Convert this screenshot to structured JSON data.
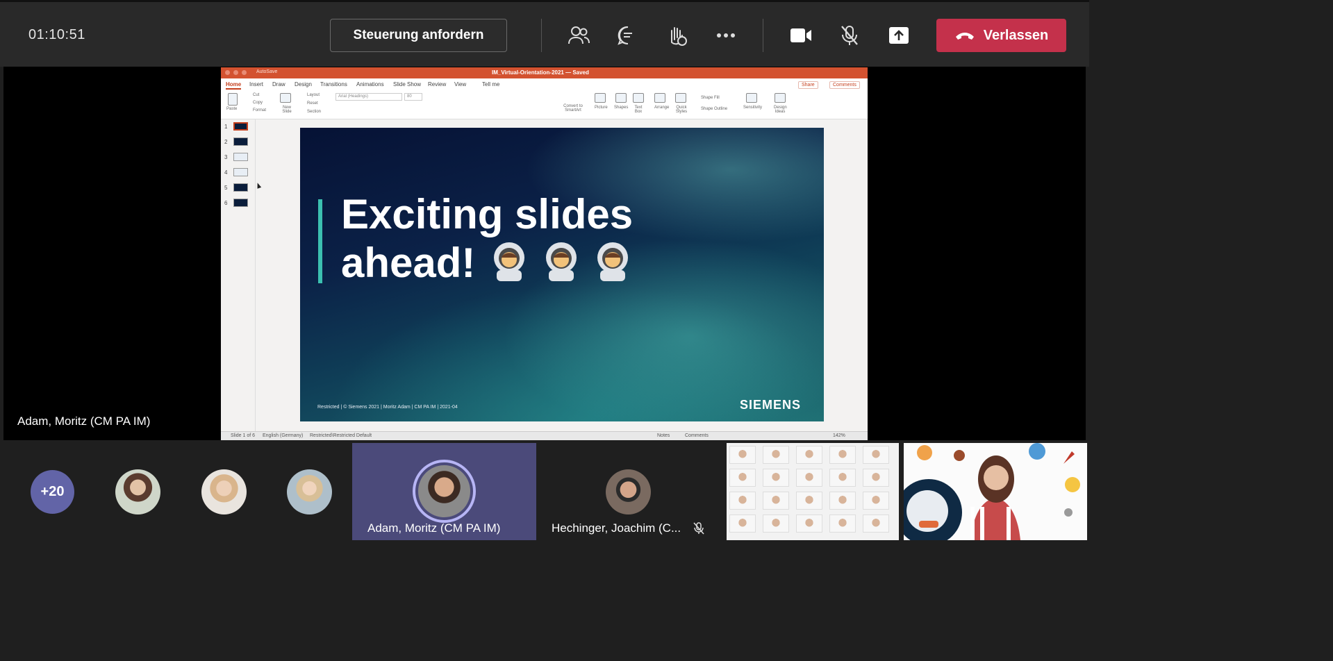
{
  "toolbar": {
    "timer": "01:10:51",
    "request_control_label": "Steuerung anfordern",
    "leave_label": "Verlassen",
    "colors": {
      "leave": "#c4314b",
      "bar": "#292929"
    }
  },
  "presenter": {
    "name": "Adam, Moritz (CM PA IM)"
  },
  "powerpoint": {
    "autosave": "AutoSave",
    "doc_title": "IM_Virtual-Orientation-2021 — Saved",
    "tabs": [
      "Home",
      "Insert",
      "Draw",
      "Design",
      "Transitions",
      "Animations",
      "Slide Show",
      "Review",
      "View",
      "Tell me"
    ],
    "share_label": "Share",
    "comments_label": "Comments",
    "ribbon": {
      "paste": "Paste",
      "cut": "Cut",
      "copy": "Copy",
      "format": "Format",
      "new_slide": "New Slide",
      "layout": "Layout",
      "reset": "Reset",
      "section": "Section",
      "font": "Arial (Headings)",
      "size": "80",
      "convert": "Convert to SmartArt",
      "picture": "Picture",
      "shapes": "Shapes",
      "text_box": "Text Box",
      "arrange": "Arrange",
      "quick_styles": "Quick Styles",
      "shape_fill": "Shape Fill",
      "shape_outline": "Shape Outline",
      "sensitivity": "Sensitivity",
      "design_ideas": "Design Ideas"
    },
    "thumbnails": [
      "1",
      "2",
      "3",
      "4",
      "5",
      "6"
    ],
    "slide": {
      "title_line1": "Exciting slides",
      "title_line2": "ahead!",
      "footer": "Restricted | © Siemens 2021 | Moritz Adam | CM PA IM | 2021-04",
      "logo": "SIEMENS"
    },
    "status": {
      "slide": "Slide 1 of 6",
      "language": "English (Germany)",
      "sensitivity": "Restricted\\Restricted Default",
      "notes": "Notes",
      "comments": "Comments",
      "zoom": "142%"
    }
  },
  "participants": {
    "more_count": "+20",
    "active_speaker": "Adam, Moritz (CM PA IM)",
    "second_tile": "Hechinger, Joachim (C..."
  }
}
